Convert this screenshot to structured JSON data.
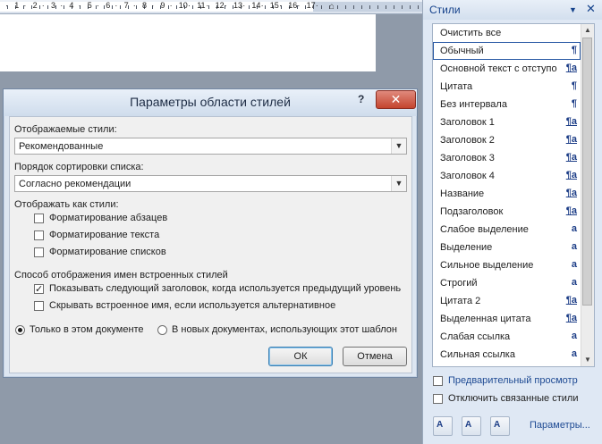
{
  "ruler": {
    "labels": [
      "·",
      "1",
      "·",
      "2",
      "·",
      "3",
      "·",
      "4",
      "·",
      "5",
      "·",
      "6",
      "·",
      "7",
      "·",
      "8",
      "·",
      "9",
      "·",
      "10",
      "·",
      "11",
      "·",
      "12",
      "·",
      "13",
      "·",
      "14",
      "·",
      "15",
      "·",
      "16",
      "·",
      "17",
      "·"
    ]
  },
  "dialog": {
    "title": "Параметры области стилей",
    "help": "?",
    "close": "✕",
    "shown_styles_label": "Отображаемые стили:",
    "shown_styles_value": "Рекомендованные",
    "sort_label": "Порядок сортировки списка:",
    "sort_value": "Согласно рекомендации",
    "show_as_label": "Отображать как стили:",
    "cb_paragraph": "Форматирование абзацев",
    "cb_text": "Форматирование текста",
    "cb_lists": "Форматирование списков",
    "builtin_label": "Способ отображения имен встроенных стилей",
    "cb_next_heading": "Показывать следующий заголовок, когда используется предыдущий уровень",
    "cb_hide_builtin": "Скрывать встроенное имя, если используется альтернативное",
    "radio_doc": "Только в этом документе",
    "radio_template": "В новых документах, использующих этот шаблон",
    "ok": "ОК",
    "cancel": "Отмена"
  },
  "pane": {
    "title": "Стили",
    "dropdown": "▼",
    "close": "✕",
    "items": [
      {
        "name": "Очистить все",
        "icon": ""
      },
      {
        "name": "Обычный",
        "icon": "¶"
      },
      {
        "name": "Основной текст с отступо",
        "icon": "¶a"
      },
      {
        "name": "Цитата",
        "icon": "¶"
      },
      {
        "name": "Без интервала",
        "icon": "¶"
      },
      {
        "name": "Заголовок 1",
        "icon": "¶a"
      },
      {
        "name": "Заголовок 2",
        "icon": "¶a"
      },
      {
        "name": "Заголовок 3",
        "icon": "¶a"
      },
      {
        "name": "Заголовок 4",
        "icon": "¶a"
      },
      {
        "name": "Название",
        "icon": "¶a"
      },
      {
        "name": "Подзаголовок",
        "icon": "¶a"
      },
      {
        "name": "Слабое выделение",
        "icon": "a"
      },
      {
        "name": "Выделение",
        "icon": "a"
      },
      {
        "name": "Сильное выделение",
        "icon": "a"
      },
      {
        "name": "Строгий",
        "icon": "a"
      },
      {
        "name": "Цитата 2",
        "icon": "¶a"
      },
      {
        "name": "Выделенная цитата",
        "icon": "¶a"
      },
      {
        "name": "Слабая ссылка",
        "icon": "a"
      },
      {
        "name": "Сильная ссылка",
        "icon": "a"
      }
    ],
    "preview_label": "Предварительный просмотр",
    "linked_label": "Отключить связанные стили",
    "params_link": "Параметры...",
    "btn_new_glyph": "A",
    "btn_inspect_glyph": "A",
    "btn_manage_glyph": "A"
  }
}
